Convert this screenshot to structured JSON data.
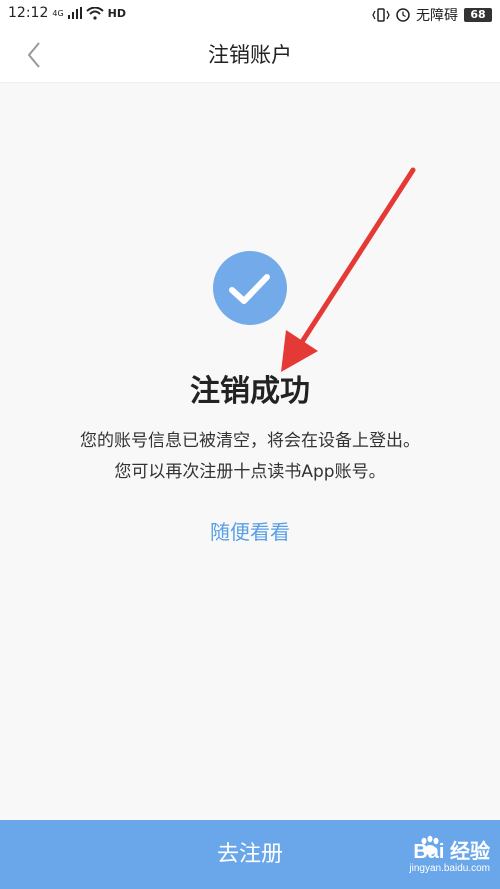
{
  "status_bar": {
    "time": "12:12",
    "network": "4G",
    "hd": "HD",
    "accessibility": "无障碍",
    "battery": "68"
  },
  "nav": {
    "title": "注销账户"
  },
  "content": {
    "title": "注销成功",
    "line1": "您的账号信息已被清空，将会在设备上登出。",
    "line2": "您可以再次注册十点读书App账号。",
    "browse_link": "随便看看"
  },
  "footer": {
    "register_label": "去注册"
  },
  "watermark": {
    "brand": "Bai 经验",
    "url": "jingyan.baidu.com"
  },
  "colors": {
    "accent": "#6aa7ea",
    "link": "#5aa0e6",
    "check_circle": "#73aaea",
    "annotation_arrow": "#e53935"
  }
}
